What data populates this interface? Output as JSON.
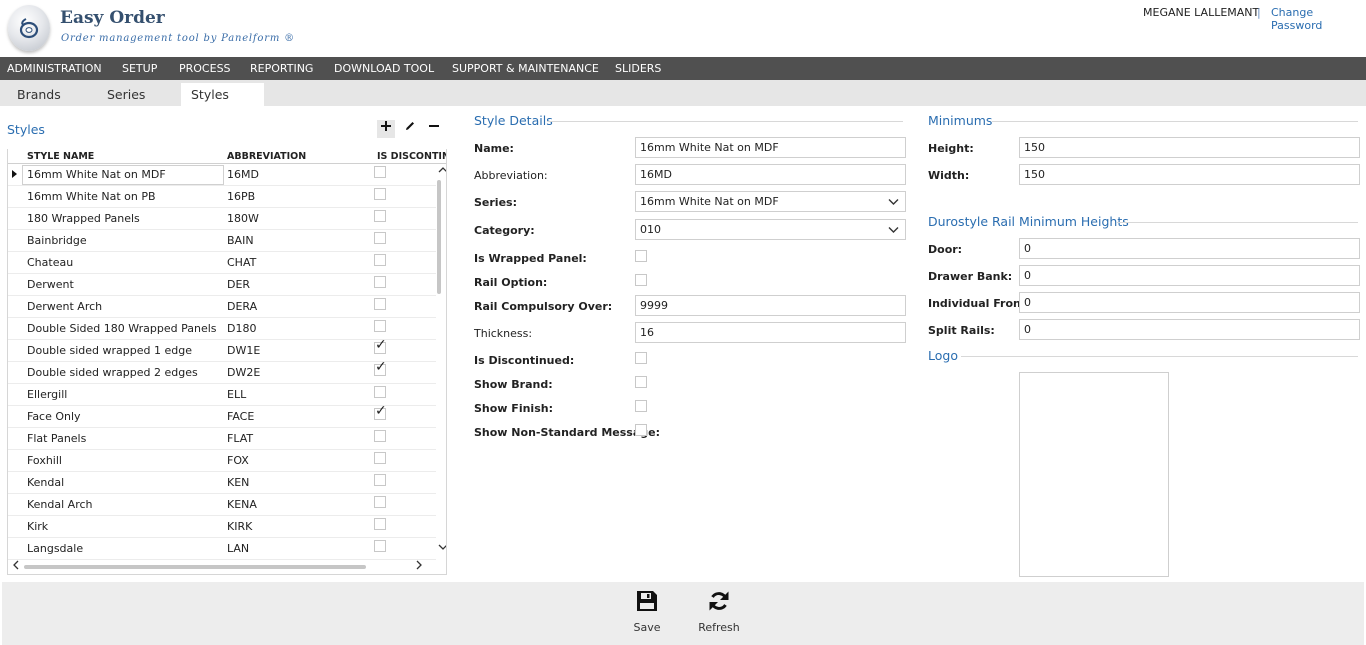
{
  "header": {
    "app_title": "Easy Order",
    "app_subtitle": "Order management tool by Panelform ®",
    "user_name": "MEGANE LALLEMANT",
    "separator": "|",
    "change_password": "Change Password"
  },
  "menu": [
    "ADMINISTRATION",
    "SETUP",
    "PROCESS",
    "REPORTING",
    "DOWNLOAD TOOL",
    "SUPPORT & MAINTENANCE",
    "SLIDERS"
  ],
  "tabs": [
    "Brands",
    "Series",
    "Styles"
  ],
  "active_tab": "Styles",
  "styles_panel": {
    "title": "Styles",
    "columns": [
      "STYLE NAME",
      "ABBREVIATION",
      "IS DISCONTINU"
    ],
    "rows": [
      {
        "name": "16mm White Nat on MDF",
        "abbr": "16MD",
        "discontinued": ""
      },
      {
        "name": "16mm White Nat on PB",
        "abbr": "16PB",
        "discontinued": ""
      },
      {
        "name": "180 Wrapped Panels",
        "abbr": "180W",
        "discontinued": ""
      },
      {
        "name": "Bainbridge",
        "abbr": "BAIN",
        "discontinued": ""
      },
      {
        "name": "Chateau",
        "abbr": "CHAT",
        "discontinued": ""
      },
      {
        "name": "Derwent",
        "abbr": "DER",
        "discontinued": ""
      },
      {
        "name": "Derwent Arch",
        "abbr": "DERA",
        "discontinued": ""
      },
      {
        "name": "Double Sided 180 Wrapped Panels",
        "abbr": "D180",
        "discontinued": ""
      },
      {
        "name": "Double sided wrapped 1 edge",
        "abbr": "DW1E",
        "discontinued": "✓"
      },
      {
        "name": "Double sided wrapped 2 edges",
        "abbr": "DW2E",
        "discontinued": "✓"
      },
      {
        "name": "Ellergill",
        "abbr": "ELL",
        "discontinued": ""
      },
      {
        "name": "Face Only",
        "abbr": "FACE",
        "discontinued": "✓"
      },
      {
        "name": "Flat Panels",
        "abbr": "FLAT",
        "discontinued": ""
      },
      {
        "name": "Foxhill",
        "abbr": "FOX",
        "discontinued": ""
      },
      {
        "name": "Kendal",
        "abbr": "KEN",
        "discontinued": ""
      },
      {
        "name": "Kendal Arch",
        "abbr": "KENA",
        "discontinued": ""
      },
      {
        "name": "Kirk",
        "abbr": "KIRK",
        "discontinued": ""
      },
      {
        "name": "Langsdale",
        "abbr": "LAN",
        "discontinued": ""
      }
    ]
  },
  "style_details": {
    "title": "Style Details",
    "name_label": "Name:",
    "name_value": "16mm White Nat on MDF",
    "abbr_label": "Abbreviation:",
    "abbr_value": "16MD",
    "series_label": "Series:",
    "series_value": "16mm White Nat on MDF",
    "category_label": "Category:",
    "category_value": "010",
    "wrapped_label": "Is Wrapped Panel:",
    "rail_option_label": "Rail Option:",
    "rail_compulsory_label": "Rail Compulsory Over:",
    "rail_compulsory_value": "9999",
    "thickness_label": "Thickness:",
    "thickness_value": "16",
    "discontinued_label": "Is Discontinued:",
    "show_brand_label": "Show Brand:",
    "show_finish_label": "Show Finish:",
    "show_nonstd_label": "Show Non-Standard Message:"
  },
  "minimums": {
    "title": "Minimums",
    "height_label": "Height:",
    "height_value": "150",
    "width_label": "Width:",
    "width_value": "150"
  },
  "durostyle": {
    "title": "Durostyle Rail Minimum Heights",
    "door_label": "Door:",
    "door_value": "0",
    "drawer_label": "Drawer Bank:",
    "drawer_value": "0",
    "individual_label": "Individual Front:",
    "individual_value": "0",
    "split_label": "Split Rails:",
    "split_value": "0"
  },
  "logo_section": {
    "title": "Logo"
  },
  "footer": {
    "save_label": "Save",
    "refresh_label": "Refresh"
  },
  "colors": {
    "accent": "#2a6db0",
    "menubar": "#505050",
    "tabbar": "#e6e6e6",
    "footer": "#ededed"
  }
}
